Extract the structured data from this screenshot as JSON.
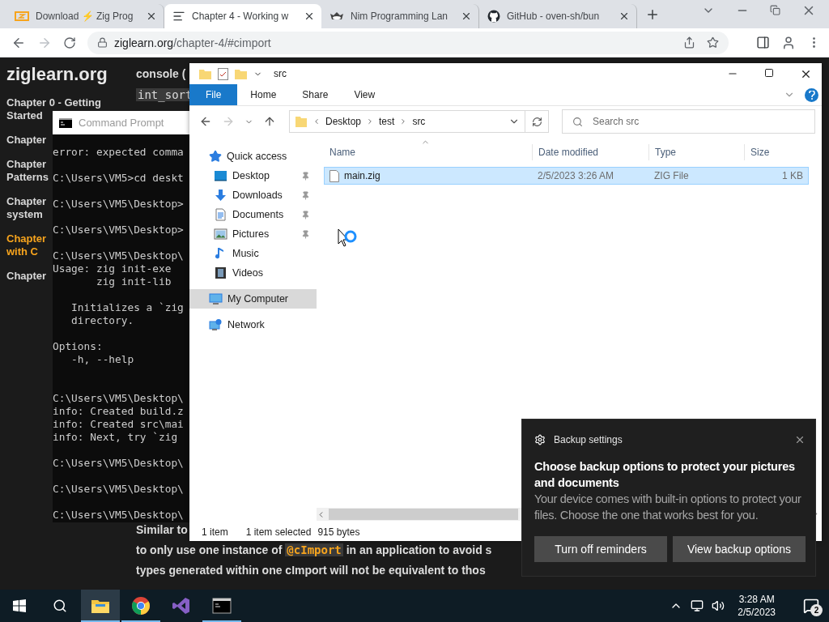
{
  "browser": {
    "tabs": [
      {
        "kind": "zig",
        "title": "Download ⚡ Zig Prog",
        "selected": false
      },
      {
        "kind": "page",
        "title": "Chapter 4 - Working w",
        "selected": true
      },
      {
        "kind": "nim",
        "title": "Nim Programming Lan",
        "selected": false
      },
      {
        "kind": "github",
        "title": "GitHub - oven-sh/bun",
        "selected": false
      }
    ],
    "forward_disabled": true,
    "url_host": "ziglearn.org",
    "url_path": "/chapter-4/#cimport"
  },
  "page": {
    "site_title": "ziglearn.org",
    "nav": [
      {
        "lines": [
          "Chapter 0 - Getting",
          "Started"
        ],
        "selected": false
      },
      {
        "lines": [
          "Chapter"
        ],
        "selected": false
      },
      {
        "lines": [
          "Chapter",
          "Patterns"
        ],
        "selected": false
      },
      {
        "lines": [
          "Chapter",
          "system"
        ],
        "selected": false
      },
      {
        "lines": [
          "Chapter",
          "with C"
        ],
        "selected": true
      },
      {
        "lines": [
          "Chapter"
        ],
        "selected": false
      }
    ],
    "top_lines": [
      "console ("
    ],
    "top_code": "int_sort",
    "bottom_first": "Similar to",
    "bottom_second": {
      "before": "to only use one instance of ",
      "code": "@cImport",
      "after": " in an application to avoid s"
    },
    "bottom_third": "types generated within one cImport will not be equivalent to thos"
  },
  "console": {
    "title": "Command Prompt",
    "blocks": [
      [
        "error: expected comma"
      ],
      [
        "C:\\Users\\VM5>cd deskt"
      ],
      [
        "C:\\Users\\VM5\\Desktop>"
      ],
      [
        "C:\\Users\\VM5\\Desktop>"
      ],
      [
        "C:\\Users\\VM5\\Desktop\\",
        "Usage: zig init-exe",
        "       zig init-lib"
      ],
      [
        "   Initializes a `zig",
        "   directory."
      ],
      [
        "Options:",
        "   -h, --help"
      ],
      [
        "C:\\Users\\VM5\\Desktop\\",
        "info: Created build.z",
        "info: Created src\\mai",
        "info: Next, try `zig"
      ],
      [
        "C:\\Users\\VM5\\Desktop\\"
      ],
      [
        "C:\\Users\\VM5\\Desktop\\"
      ],
      [
        "C:\\Users\\VM5\\Desktop\\"
      ]
    ]
  },
  "explorer": {
    "title": "src",
    "ribbon_tabs": [
      {
        "label": "File",
        "selected": true
      },
      {
        "label": "Home",
        "selected": false
      },
      {
        "label": "Share",
        "selected": false
      },
      {
        "label": "View",
        "selected": false
      }
    ],
    "nav_buttons": [
      {
        "kind": "back",
        "disabled": false
      },
      {
        "kind": "forward",
        "disabled": true
      },
      {
        "kind": "recent",
        "disabled": false
      },
      {
        "kind": "up",
        "disabled": false
      }
    ],
    "breadcrumb": [
      "Desktop",
      "test",
      "src"
    ],
    "search": {
      "placeholder": "Search src"
    },
    "sidebar": [
      {
        "kind": "star",
        "label": "Quick access",
        "pinned": false,
        "selected": false
      },
      {
        "kind": "desktop",
        "label": "Desktop",
        "pinned": true,
        "selected": false
      },
      {
        "kind": "download",
        "label": "Downloads",
        "pinned": true,
        "selected": false
      },
      {
        "kind": "document",
        "label": "Documents",
        "pinned": true,
        "selected": false
      },
      {
        "kind": "pictures",
        "label": "Pictures",
        "pinned": true,
        "selected": false
      },
      {
        "kind": "music",
        "label": "Music",
        "pinned": false,
        "selected": false
      },
      {
        "kind": "videos",
        "label": "Videos",
        "pinned": false,
        "selected": false
      },
      {
        "kind": "computer",
        "label": "My Computer",
        "pinned": false,
        "selected": true
      },
      {
        "kind": "network",
        "label": "Network",
        "pinned": false,
        "selected": false
      }
    ],
    "columns": [
      "Name",
      "Date modified",
      "Type",
      "Size"
    ],
    "rows": [
      {
        "name": "main.zig",
        "date": "2/5/2023 3:26 AM",
        "type": "ZIG File",
        "size": "1 KB",
        "selected": true
      }
    ],
    "status_count": "1 item",
    "status_selected": "1 item selected",
    "status_size": "915 bytes"
  },
  "notification": {
    "app": "Backup settings",
    "title": "Choose backup options to protect your pictures and documents",
    "body": "Your device comes with built-in options to protect your files. Choose the one that works best for you.",
    "buttons": [
      "Turn off reminders",
      "View backup options"
    ]
  },
  "taskbar": {
    "apps": [
      {
        "kind": "explorer",
        "active": true,
        "running": true
      },
      {
        "kind": "chrome",
        "active": false,
        "running": true
      },
      {
        "kind": "studio",
        "active": false,
        "running": false
      },
      {
        "kind": "console",
        "active": false,
        "running": true
      }
    ],
    "time": "3:28 AM",
    "date": "2/5/2023",
    "notification_count": "2"
  }
}
